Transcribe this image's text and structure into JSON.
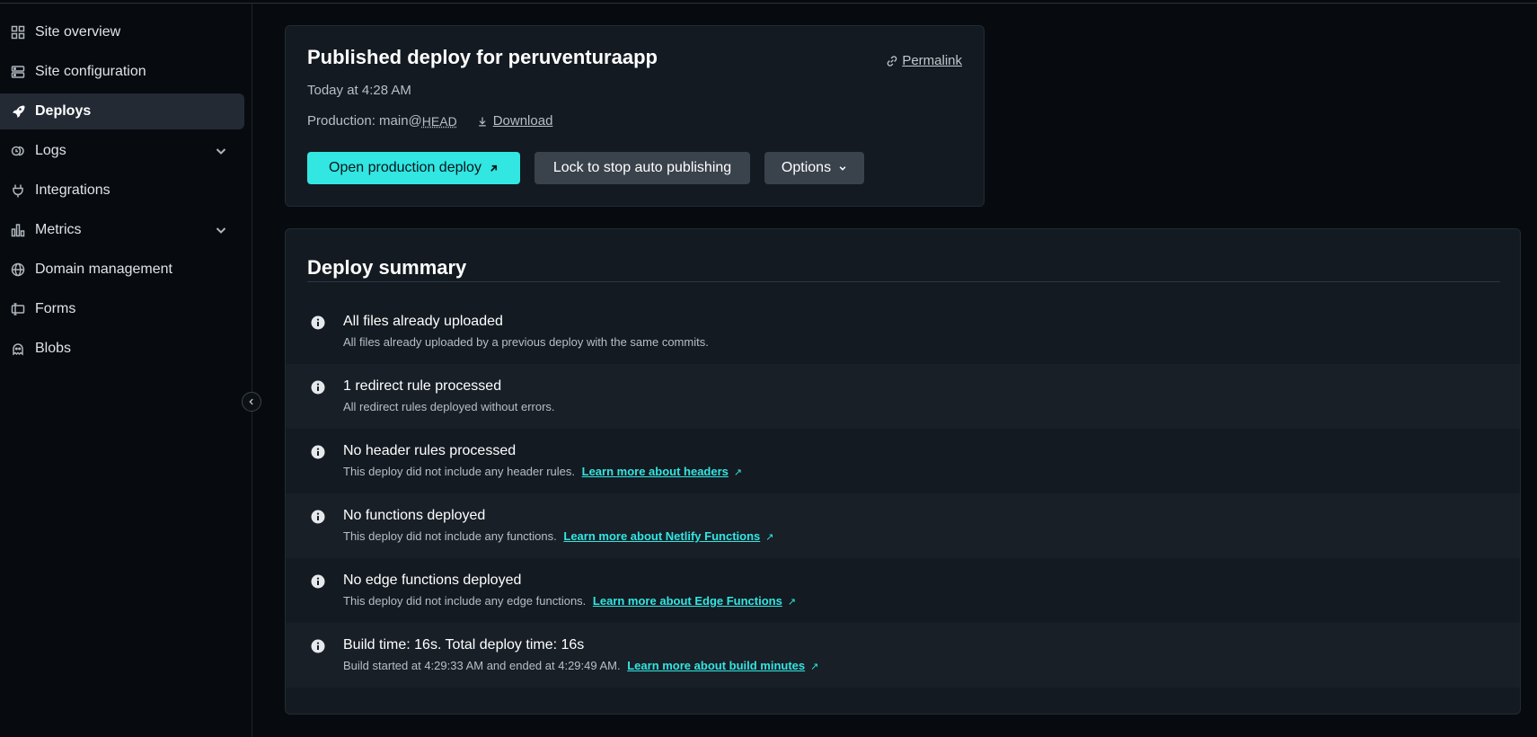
{
  "sidebar": {
    "items": [
      {
        "label": "Site overview",
        "icon": "grid-icon"
      },
      {
        "label": "Site configuration",
        "icon": "server-icon"
      },
      {
        "label": "Deploys",
        "icon": "rocket-icon",
        "active": true
      },
      {
        "label": "Logs",
        "icon": "logs-icon",
        "expandable": true
      },
      {
        "label": "Integrations",
        "icon": "plug-icon"
      },
      {
        "label": "Metrics",
        "icon": "bar-chart-icon",
        "expandable": true
      },
      {
        "label": "Domain management",
        "icon": "globe-icon"
      },
      {
        "label": "Forms",
        "icon": "forms-icon"
      },
      {
        "label": "Blobs",
        "icon": "blob-icon"
      }
    ]
  },
  "deploy": {
    "title": "Published deploy for peruventuraapp",
    "permalink": "Permalink",
    "time": "Today at 4:28 AM",
    "production_prefix": "Production: main@",
    "production_ref": "HEAD",
    "download": "Download",
    "open_button": "Open production deploy",
    "lock_button": "Lock to stop auto publishing",
    "options_button": "Options"
  },
  "summary": {
    "title": "Deploy summary",
    "rows": [
      {
        "title": "All files already uploaded",
        "desc": "All files already uploaded by a previous deploy with the same commits.",
        "link": ""
      },
      {
        "title": "1 redirect rule processed",
        "desc": "All redirect rules deployed without errors.",
        "link": ""
      },
      {
        "title": "No header rules processed",
        "desc": "This deploy did not include any header rules.",
        "link": "Learn more about headers"
      },
      {
        "title": "No functions deployed",
        "desc": "This deploy did not include any functions.",
        "link": "Learn more about Netlify Functions"
      },
      {
        "title": "No edge functions deployed",
        "desc": "This deploy did not include any edge functions.",
        "link": "Learn more about Edge Functions"
      },
      {
        "title": "Build time: 16s. Total deploy time: 16s",
        "desc": "Build started at 4:29:33 AM and ended at 4:29:49 AM.",
        "link": "Learn more about build minutes"
      }
    ]
  },
  "colors": {
    "accent": "#32e6e2",
    "background": "#070b0f",
    "card": "#141a21",
    "button_secondary": "#3a424c"
  }
}
